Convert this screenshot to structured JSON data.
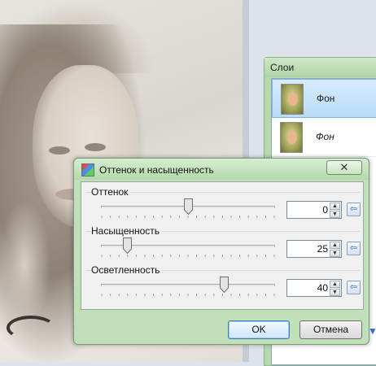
{
  "layers_panel": {
    "title": "Слои",
    "items": [
      {
        "name": "Фон",
        "selected": true,
        "italic": false
      },
      {
        "name": "Фон",
        "selected": false,
        "italic": true
      }
    ]
  },
  "dialog": {
    "title": "Оттенок и насыщенность",
    "close_label": "✕",
    "sliders": [
      {
        "label": "Оттенок",
        "value": "0",
        "min": -180,
        "max": 180,
        "numeric": 0
      },
      {
        "label": "Насыщенность",
        "value": "25",
        "min": 0,
        "max": 200,
        "numeric": 25
      },
      {
        "label": "Осветленность",
        "value": "40",
        "min": -100,
        "max": 100,
        "numeric": 40
      }
    ],
    "ok_label": "OK",
    "cancel_label": "Отмена",
    "reset_icon": "reset-arrow-icon"
  },
  "colors": {
    "window_frame": "#bfe0b8",
    "selection": "#b9dcf7",
    "ok_border": "#3c7fb1"
  }
}
